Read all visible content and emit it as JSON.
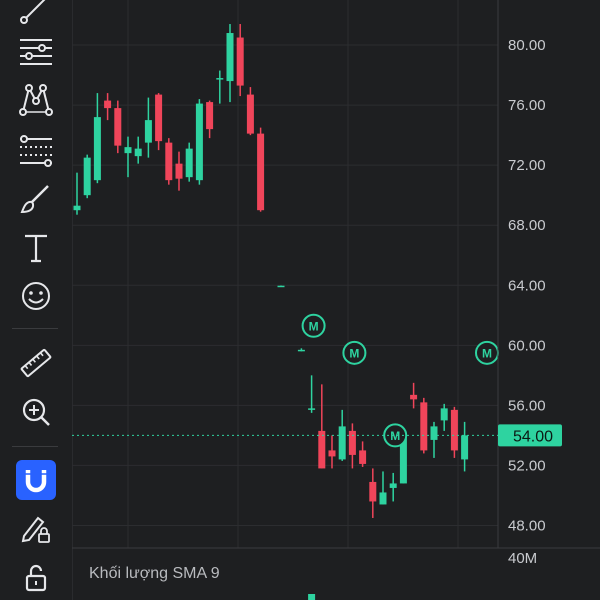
{
  "toolbar": {
    "tools": [
      {
        "icon": "trend-line-icon",
        "active": false
      },
      {
        "icon": "horizontal-lines-icon",
        "active": false
      },
      {
        "icon": "pattern-icon",
        "active": false
      },
      {
        "icon": "fib-levels-icon",
        "active": false
      },
      {
        "icon": "brush-icon",
        "active": false
      },
      {
        "icon": "text-icon",
        "active": false
      },
      {
        "icon": "emoji-icon",
        "active": false
      },
      {
        "icon": "ruler-icon",
        "active": false
      },
      {
        "icon": "zoom-in-icon",
        "active": false
      },
      {
        "icon": "magnet-icon",
        "active": true
      },
      {
        "icon": "lock-drawing-icon",
        "active": false
      },
      {
        "icon": "lock-icon",
        "active": false
      }
    ],
    "colors": {
      "active_bg": "#2962ff",
      "icon": "#e6e7ea"
    }
  },
  "chart_data": {
    "type": "candlestick",
    "y_ticks": [
      "80.00",
      "76.00",
      "72.00",
      "68.00",
      "64.00",
      "60.00",
      "56.00",
      "52.00",
      "48.00"
    ],
    "ylim": [
      46.5,
      83
    ],
    "current_price": "54.00",
    "current_price_value": 54.0,
    "volume_panel": {
      "title": "Khối lượng SMA 9",
      "tick": "40M"
    },
    "colors": {
      "up": "#2ed3a0",
      "down": "#f0455a",
      "grid": "#2c2d30",
      "background": "#1e1f21",
      "price_line": "#2ed3a0"
    },
    "grid": true,
    "candles": [
      {
        "o": 69.0,
        "h": 71.5,
        "l": 68.7,
        "c": 69.3
      },
      {
        "o": 70.0,
        "h": 72.7,
        "l": 69.8,
        "c": 72.5
      },
      {
        "o": 71.0,
        "h": 76.8,
        "l": 70.8,
        "c": 75.2
      },
      {
        "o": 76.3,
        "h": 76.8,
        "l": 75.0,
        "c": 75.8
      },
      {
        "o": 75.8,
        "h": 76.3,
        "l": 72.8,
        "c": 73.3
      },
      {
        "o": 72.8,
        "h": 73.9,
        "l": 71.2,
        "c": 73.2
      },
      {
        "o": 72.6,
        "h": 73.9,
        "l": 72.1,
        "c": 73.1
      },
      {
        "o": 73.5,
        "h": 76.5,
        "l": 72.5,
        "c": 75.0
      },
      {
        "o": 76.7,
        "h": 76.8,
        "l": 73.0,
        "c": 73.6
      },
      {
        "o": 73.5,
        "h": 73.8,
        "l": 70.7,
        "c": 71.0
      },
      {
        "o": 72.1,
        "h": 72.9,
        "l": 70.3,
        "c": 71.1
      },
      {
        "o": 71.2,
        "h": 73.5,
        "l": 70.9,
        "c": 73.1
      },
      {
        "o": 71.0,
        "h": 76.4,
        "l": 70.7,
        "c": 76.1
      },
      {
        "o": 76.2,
        "h": 76.3,
        "l": 73.8,
        "c": 74.4
      },
      {
        "o": 77.8,
        "h": 78.3,
        "l": 76.1,
        "c": 77.8
      },
      {
        "o": 77.6,
        "h": 81.4,
        "l": 76.2,
        "c": 80.8
      },
      {
        "o": 80.5,
        "h": 81.4,
        "l": 76.6,
        "c": 77.3
      },
      {
        "o": 76.7,
        "h": 77.2,
        "l": 74.0,
        "c": 74.1
      },
      {
        "o": 74.1,
        "h": 74.5,
        "l": 68.9,
        "c": 69.0
      },
      null,
      {
        "o": 63.96,
        "h": 63.98,
        "l": 63.94,
        "c": 63.97
      },
      null,
      {
        "o": 59.7,
        "h": 59.8,
        "l": 59.6,
        "c": 59.7
      },
      {
        "o": 55.8,
        "h": 58.0,
        "l": 55.5,
        "c": 55.8
      },
      {
        "o": 54.3,
        "h": 57.4,
        "l": 51.8,
        "c": 51.8
      },
      {
        "o": 53.0,
        "h": 54.0,
        "l": 51.8,
        "c": 52.6
      },
      {
        "o": 52.4,
        "h": 55.7,
        "l": 52.3,
        "c": 54.6
      },
      {
        "o": 54.3,
        "h": 54.8,
        "l": 51.8,
        "c": 52.7
      },
      {
        "o": 53.0,
        "h": 53.6,
        "l": 51.9,
        "c": 52.1
      },
      {
        "o": 50.9,
        "h": 51.8,
        "l": 48.5,
        "c": 49.6
      },
      {
        "o": 49.4,
        "h": 51.6,
        "l": 49.4,
        "c": 50.2
      },
      {
        "o": 50.5,
        "h": 51.5,
        "l": 49.6,
        "c": 50.8
      },
      {
        "o": 50.8,
        "h": 54.2,
        "l": 50.8,
        "c": 53.8
      },
      {
        "o": 56.7,
        "h": 57.5,
        "l": 55.8,
        "c": 56.4
      },
      {
        "o": 56.2,
        "h": 56.5,
        "l": 52.8,
        "c": 53.0
      },
      {
        "o": 53.7,
        "h": 54.9,
        "l": 52.5,
        "c": 54.6
      },
      {
        "o": 55.0,
        "h": 56.1,
        "l": 54.3,
        "c": 55.8
      },
      {
        "o": 55.7,
        "h": 55.9,
        "l": 52.5,
        "c": 53.0
      },
      {
        "o": 52.4,
        "h": 54.9,
        "l": 51.6,
        "c": 54.0
      }
    ],
    "markers": [
      {
        "label": "M",
        "index": 23,
        "price": 61.3
      },
      {
        "label": "M",
        "index": 27,
        "price": 59.5
      },
      {
        "label": "M",
        "index": 31,
        "price": 54.0
      },
      {
        "label": "M",
        "index": 40,
        "price": 59.5
      }
    ],
    "volume_bars": [
      {
        "index": 23,
        "value": 1
      }
    ]
  }
}
